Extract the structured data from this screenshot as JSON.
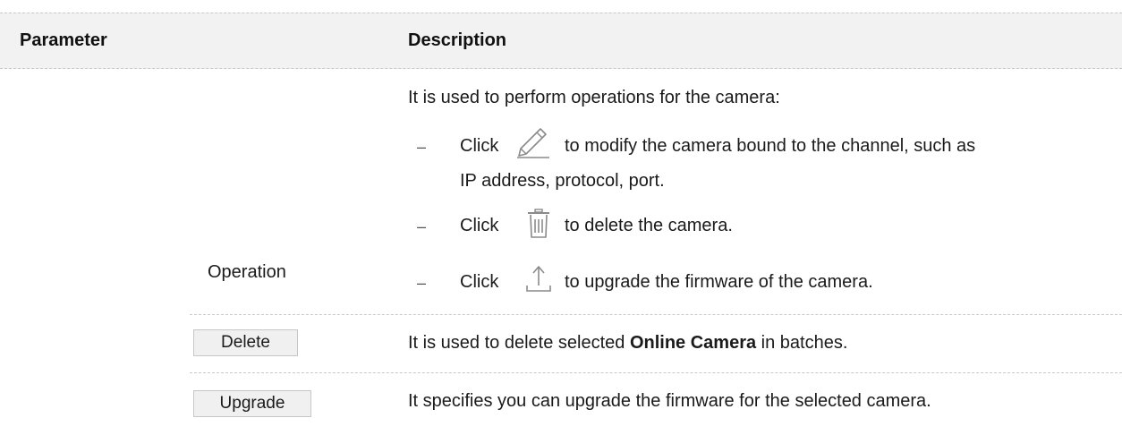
{
  "header": {
    "parameter": "Parameter",
    "description": "Description"
  },
  "rows": {
    "operation": {
      "parameter": "Operation",
      "intro": "It is used to perform operations for the camera:",
      "items": [
        {
          "bullet": "–",
          "click": "Click",
          "icon": "edit-pencil-icon",
          "text_a": "to modify the camera bound to the channel, such as",
          "text_b": "IP address, protocol, port."
        },
        {
          "bullet": "–",
          "click": "Click",
          "icon": "trash-icon",
          "text_a": "to delete the camera."
        },
        {
          "bullet": "–",
          "click": "Click",
          "icon": "upload-icon",
          "text_a": "to upgrade the firmware of the camera."
        }
      ]
    },
    "delete": {
      "button_label": "Delete",
      "desc_pre": "It is used to delete selected ",
      "desc_bold": "Online Camera",
      "desc_post": " in batches."
    },
    "upgrade": {
      "button_label": "Upgrade",
      "desc": "It specifies you can upgrade the firmware for the selected camera."
    }
  },
  "colors": {
    "header_bg": "#f2f2f2",
    "button_bg": "#f0f0f0",
    "divider": "#c8c8c8",
    "icon_stroke": "#8a8a8a"
  }
}
